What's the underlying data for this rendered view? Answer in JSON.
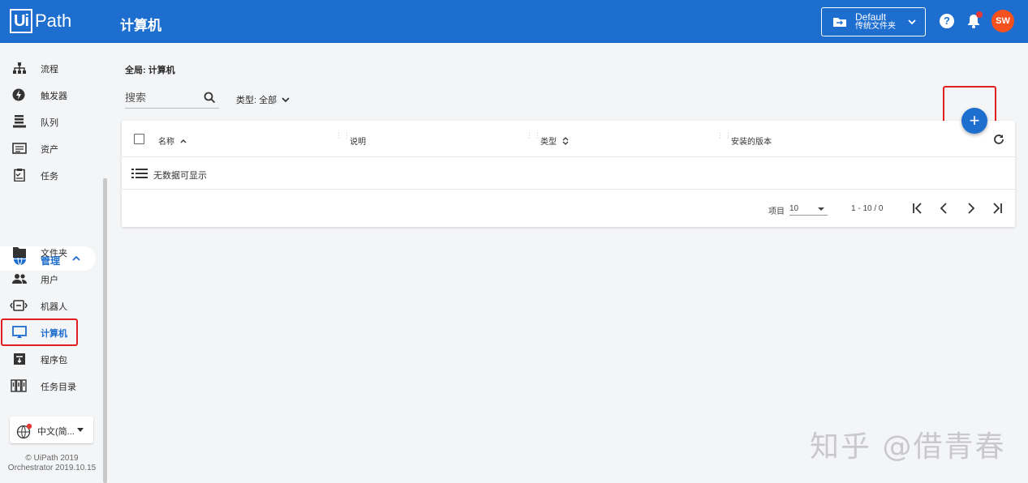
{
  "header": {
    "logo_box": "Ui",
    "logo_text": "Path",
    "title": "计算机",
    "folder": {
      "name": "Default",
      "type": "传统文件夹"
    },
    "help": "?",
    "avatar": "SW"
  },
  "sidebar": {
    "items_top": [
      {
        "label": "流程",
        "icon": "sitemap-icon"
      },
      {
        "label": "触发器",
        "icon": "bolt-icon"
      },
      {
        "label": "队列",
        "icon": "queue-icon"
      },
      {
        "label": "资产",
        "icon": "asset-icon"
      },
      {
        "label": "任务",
        "icon": "clipboard-icon"
      }
    ],
    "group": {
      "label": "管理",
      "icon": "globe-icon"
    },
    "items_admin": [
      {
        "label": "文件夹",
        "icon": "folder-icon"
      },
      {
        "label": "用户",
        "icon": "users-icon"
      },
      {
        "label": "机器人",
        "icon": "robot-icon"
      },
      {
        "label": "计算机",
        "icon": "monitor-icon",
        "active": true
      },
      {
        "label": "程序包",
        "icon": "package-icon"
      },
      {
        "label": "任务目录",
        "icon": "catalog-icon"
      }
    ],
    "language": "中文(简...",
    "copyright_line1": "© UiPath 2019",
    "copyright_line2": "Orchestrator 2019.10.15"
  },
  "main": {
    "breadcrumb": "全局: 计算机",
    "search_placeholder": "搜索",
    "type_filter": "类型: 全部",
    "add": "+",
    "table": {
      "columns": [
        "名称",
        "说明",
        "类型",
        "安装的版本"
      ],
      "empty": "无数据可显示"
    },
    "pagination": {
      "per_page_label": "项目",
      "per_page": "10",
      "range": "1 - 10 / 0"
    }
  },
  "watermark": "知乎 @借青春",
  "colors": {
    "primary": "#1e6ecf",
    "avatar": "#f4511e",
    "highlight": "#e02020"
  }
}
